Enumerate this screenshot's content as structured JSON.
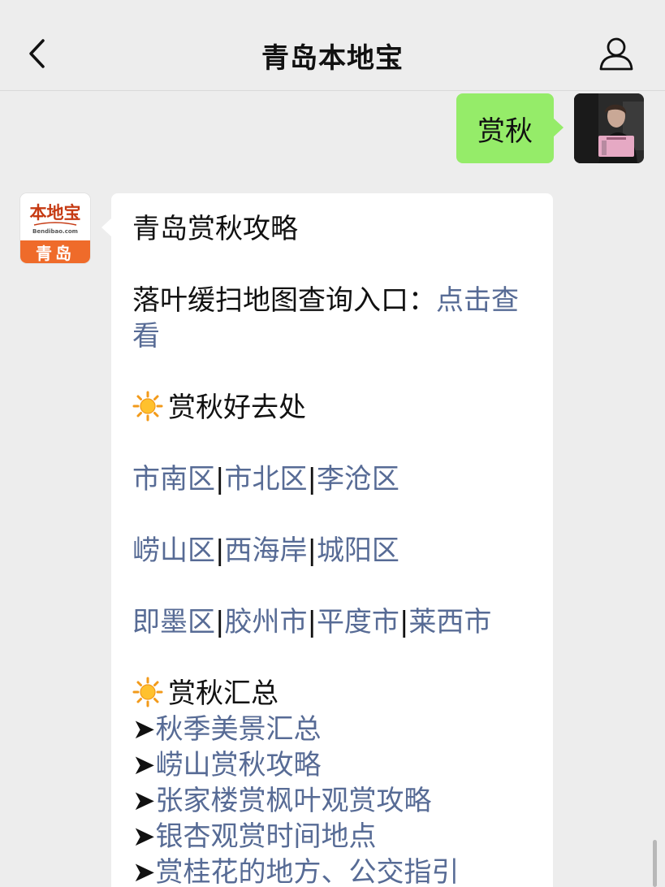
{
  "header": {
    "title": "青岛本地宝",
    "back_icon": "chevron-left-icon",
    "profile_icon": "person-icon"
  },
  "outgoing_message": {
    "text": "赏秋"
  },
  "incoming_avatar": {
    "logo_text": "本地宝",
    "logo_subtext": "Bendibao.com",
    "city": "青岛"
  },
  "incoming_message": {
    "title": "青岛赏秋攻略",
    "map_entry_label": "落叶缓扫地图查询入口：",
    "map_entry_link": "点击查看",
    "section1_heading": "赏秋好去处",
    "districts_row1": [
      "市南区",
      "市北区",
      "李沧区"
    ],
    "districts_row2": [
      "崂山区",
      "西海岸",
      "城阳区"
    ],
    "districts_row3": [
      "即墨区",
      "胶州市",
      "平度市",
      "莱西市"
    ],
    "separator": "|",
    "section2_heading": "赏秋汇总",
    "arrow": "➤",
    "summary_links": [
      "秋季美景汇总",
      "崂山赏秋攻略",
      "张家楼赏枫叶观赏攻略",
      "银杏观赏时间地点",
      "赏桂花的地方、公交指引"
    ]
  },
  "colors": {
    "background": "#ededed",
    "outgoing_bubble": "#95ec69",
    "incoming_bubble": "#ffffff",
    "link": "#576b95",
    "brand_orange": "#ef6b2a"
  }
}
